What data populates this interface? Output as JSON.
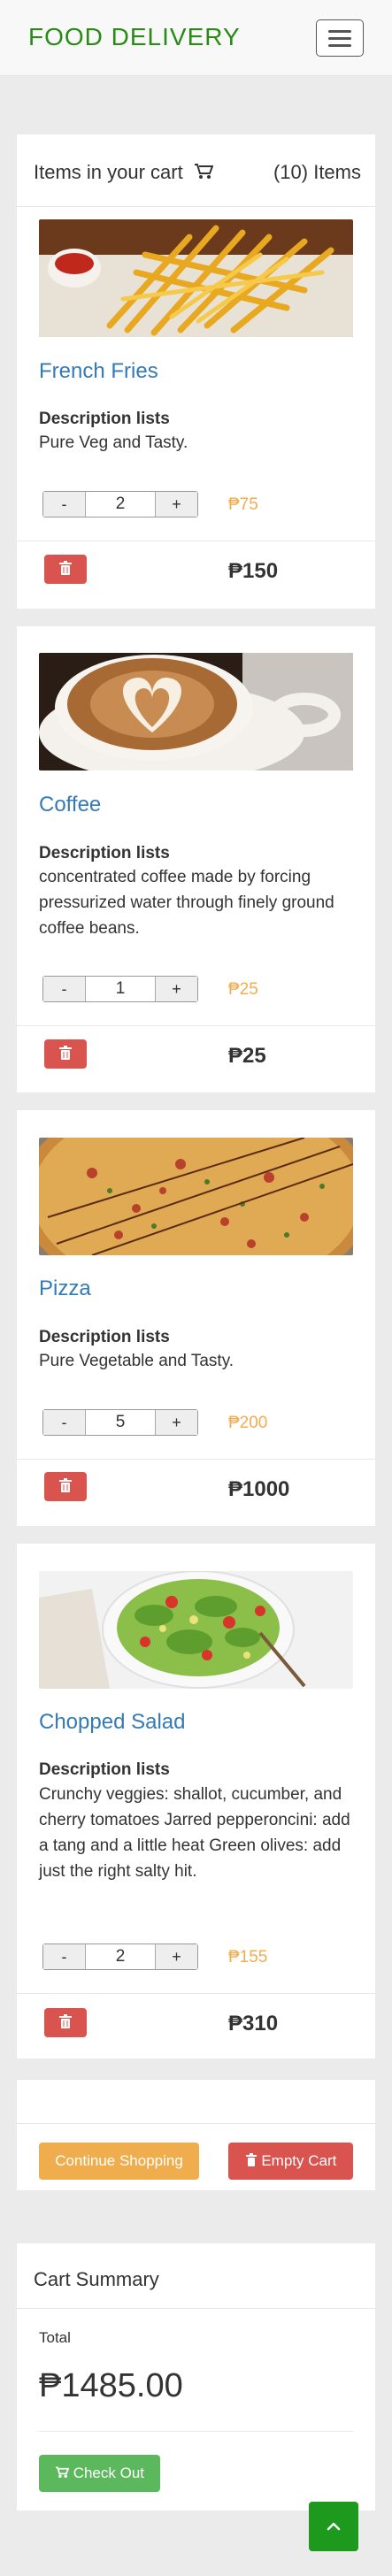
{
  "navbar": {
    "brand": "FOOD DELIVERY"
  },
  "cart": {
    "title": "Items in your cart",
    "count_text": "(10) Items",
    "items": [
      {
        "name": "French Fries",
        "desc_heading": "Description lists",
        "desc": "Pure Veg and Tasty.",
        "qty": "2",
        "price": "₱75",
        "subtotal": "₱150"
      },
      {
        "name": "Coffee",
        "desc_heading": "Description lists",
        "desc": "concentrated coffee made by forcing pressurized water through finely ground coffee beans.",
        "qty": "1",
        "price": "₱25",
        "subtotal": "₱25"
      },
      {
        "name": "Pizza",
        "desc_heading": "Description lists",
        "desc": "Pure Vegetable and Tasty.",
        "qty": "5",
        "price": "₱200",
        "subtotal": "₱1000"
      },
      {
        "name": "Chopped Salad",
        "desc_heading": "Description lists",
        "desc": "Crunchy veggies: shallot, cucumber, and cherry tomatoes Jarred pepperoncini: add a tang and a little heat Green olives: add just the right salty hit.",
        "qty": "2",
        "price": "₱155",
        "subtotal": "₱310"
      }
    ],
    "minus_label": "-",
    "plus_label": "+",
    "continue_label": "Continue Shopping",
    "empty_label": "Empty Cart"
  },
  "summary": {
    "title": "Cart Summary",
    "total_label": "Total",
    "total_value": "₱1485.00",
    "checkout_label": "Check Out"
  },
  "colors": {
    "brand": "#2a8a16",
    "link": "#337ab7",
    "price": "#f0ad4e",
    "danger": "#d9534f",
    "success": "#5cb85c"
  },
  "icons": [
    "menu-icon",
    "cart-icon",
    "trash-icon",
    "chevron-up-icon"
  ]
}
